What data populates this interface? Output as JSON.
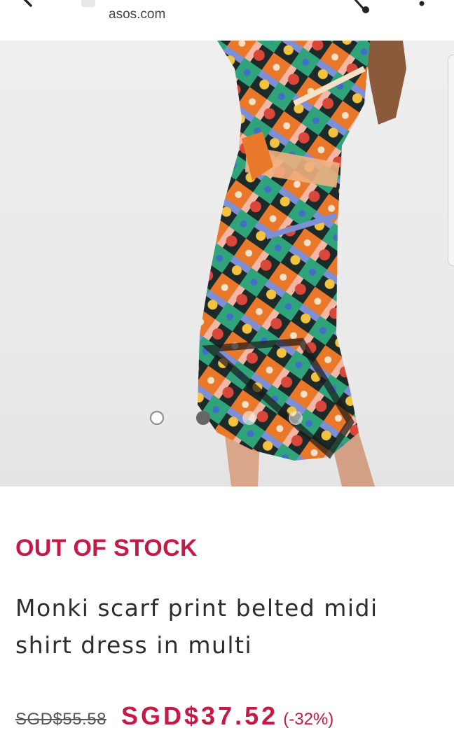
{
  "browser": {
    "url": "asos.com",
    "icons": {
      "back": "back-arrow-icon",
      "tab": "tab-icon",
      "share": "share-icon",
      "more": "more-vertical-icon"
    }
  },
  "gallery": {
    "image": "product-photo",
    "dots_total": 4,
    "active_dot": 1
  },
  "product": {
    "stock_status": "OUT OF STOCK",
    "title": "Monki scarf print belted midi shirt dress in multi",
    "old_price": "SGD$55.58",
    "price": "SGD$37.52",
    "discount": "(-32%)"
  },
  "colors": {
    "accent": "#c51a45",
    "text": "#2d2d2d",
    "background": "#ffffff"
  }
}
